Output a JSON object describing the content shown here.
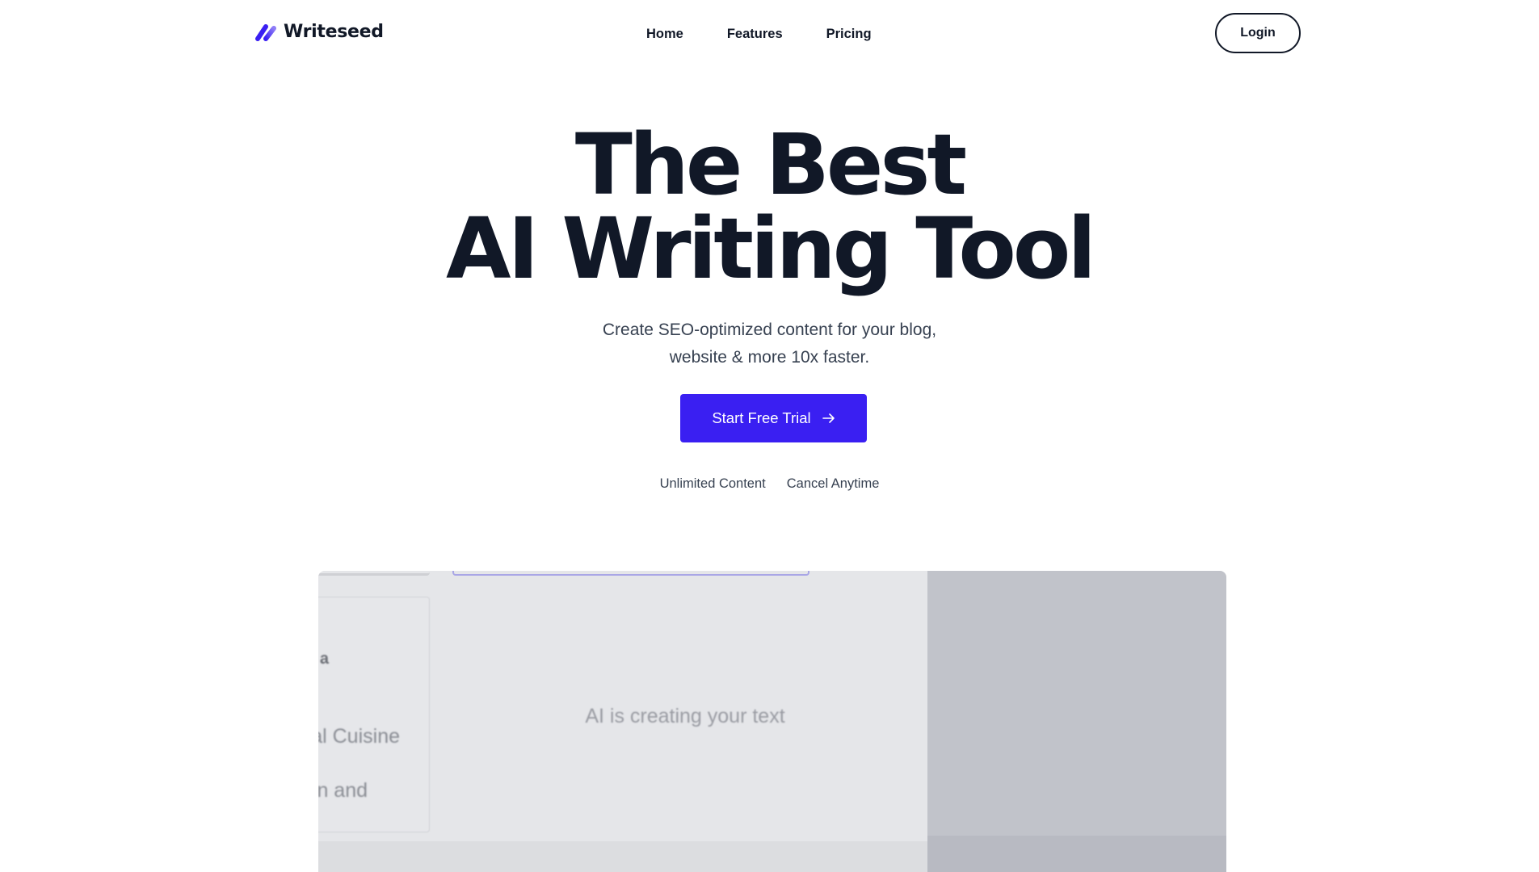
{
  "header": {
    "brand": "Writeseed",
    "nav": [
      {
        "label": "Home"
      },
      {
        "label": "Features"
      },
      {
        "label": "Pricing"
      }
    ],
    "login_label": "Login"
  },
  "hero": {
    "title_line1": "The Best",
    "title_line2": "AI Writing Tool",
    "subtitle_line1": "Create SEO-optimized content for your blog,",
    "subtitle_line2": "website & more 10x faster.",
    "cta_label": "Start Free Trial",
    "perks": [
      "Unlimited Content",
      "Cancel Anytime"
    ]
  },
  "preview": {
    "card_lines": [
      "a",
      "al Cuisine",
      "n and"
    ],
    "status_text": "AI is creating your text"
  },
  "colors": {
    "accent": "#3a1ff2",
    "text": "#111827",
    "muted": "#374151",
    "logo_gradient_start": "#4b2cf4",
    "logo_gradient_end": "#9b8cf8"
  },
  "icons": {
    "logo": "slash-logo-icon",
    "cta": "arrow-right-icon"
  }
}
